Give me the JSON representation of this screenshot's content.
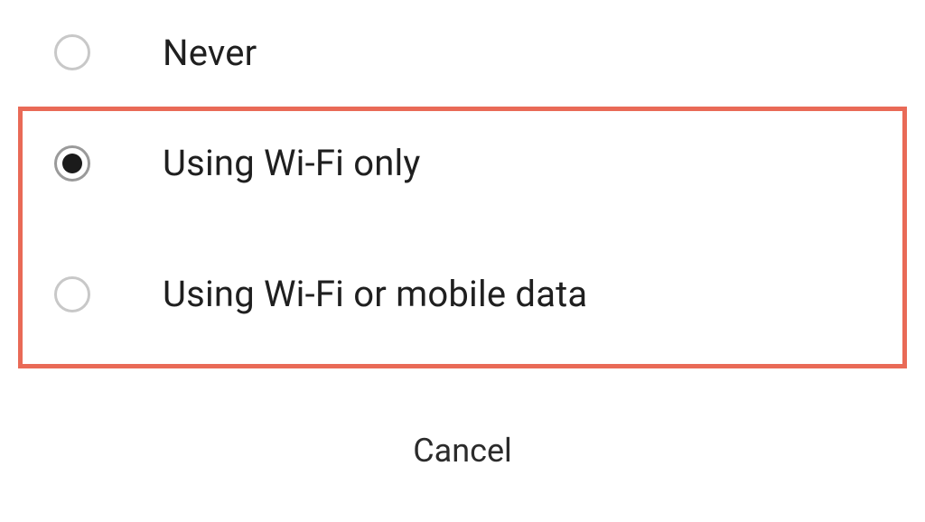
{
  "options": [
    {
      "label": "Never",
      "selected": false
    },
    {
      "label": "Using Wi-Fi only",
      "selected": true
    },
    {
      "label": "Using Wi-Fi or mobile data",
      "selected": false
    }
  ],
  "cancel_label": "Cancel",
  "highlight_color": "#e96a57"
}
